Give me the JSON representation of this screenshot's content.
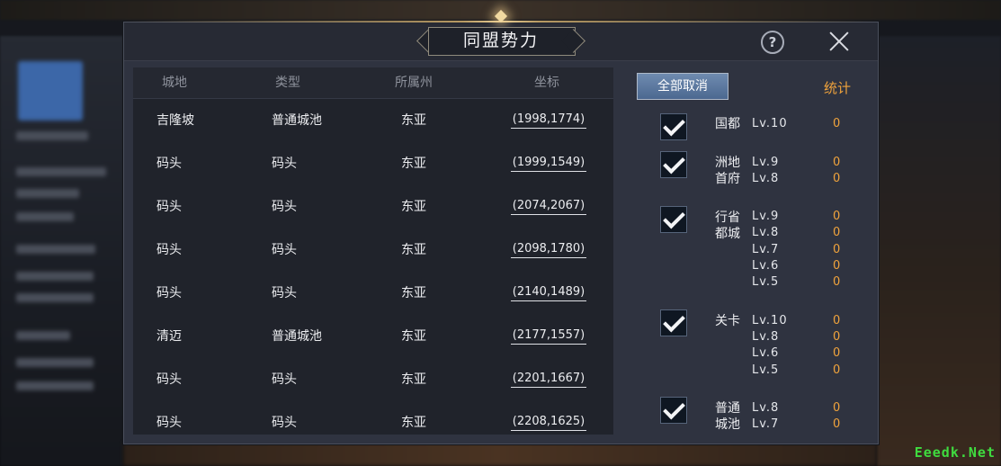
{
  "dialog": {
    "title": "同盟势力",
    "help_icon": "?"
  },
  "table": {
    "headers": [
      "城地",
      "类型",
      "所属州",
      "坐标"
    ],
    "rows": [
      {
        "city": "吉隆坡",
        "type": "普通城池",
        "region": "东亚",
        "coord": "(1998,1774)"
      },
      {
        "city": "码头",
        "type": "码头",
        "region": "东亚",
        "coord": "(1999,1549)"
      },
      {
        "city": "码头",
        "type": "码头",
        "region": "东亚",
        "coord": "(2074,2067)"
      },
      {
        "city": "码头",
        "type": "码头",
        "region": "东亚",
        "coord": "(2098,1780)"
      },
      {
        "city": "码头",
        "type": "码头",
        "region": "东亚",
        "coord": "(2140,1489)"
      },
      {
        "city": "清迈",
        "type": "普通城池",
        "region": "东亚",
        "coord": "(2177,1557)"
      },
      {
        "city": "码头",
        "type": "码头",
        "region": "东亚",
        "coord": "(2201,1667)"
      },
      {
        "city": "码头",
        "type": "码头",
        "region": "东亚",
        "coord": "(2208,1625)"
      }
    ]
  },
  "filter": {
    "cancel_all_label": "全部取消",
    "stats_label": "统计",
    "groups": [
      {
        "label": "国都",
        "checked": true,
        "levels": [
          {
            "lv": "Lv.10",
            "count": "0"
          }
        ]
      },
      {
        "label": "洲地首府",
        "checked": true,
        "levels": [
          {
            "lv": "Lv.9",
            "count": "0"
          },
          {
            "lv": "Lv.8",
            "count": "0"
          }
        ]
      },
      {
        "label": "行省都城",
        "checked": true,
        "levels": [
          {
            "lv": "Lv.9",
            "count": "0"
          },
          {
            "lv": "Lv.8",
            "count": "0"
          },
          {
            "lv": "Lv.7",
            "count": "0"
          },
          {
            "lv": "Lv.6",
            "count": "0"
          },
          {
            "lv": "Lv.5",
            "count": "0"
          }
        ]
      },
      {
        "label": "关卡",
        "checked": true,
        "levels": [
          {
            "lv": "Lv.10",
            "count": "0"
          },
          {
            "lv": "Lv.8",
            "count": "0"
          },
          {
            "lv": "Lv.6",
            "count": "0"
          },
          {
            "lv": "Lv.5",
            "count": "0"
          }
        ]
      },
      {
        "label": "普通城池",
        "checked": true,
        "levels": [
          {
            "lv": "Lv.8",
            "count": "0"
          },
          {
            "lv": "Lv.7",
            "count": "0"
          }
        ]
      }
    ]
  },
  "watermark": "Eeedk.Net",
  "colors": {
    "accent_orange": "#f0a33c",
    "button_blue": "#5a779e",
    "panel_dark": "#20232b",
    "watermark_green": "#3fdc3f"
  }
}
